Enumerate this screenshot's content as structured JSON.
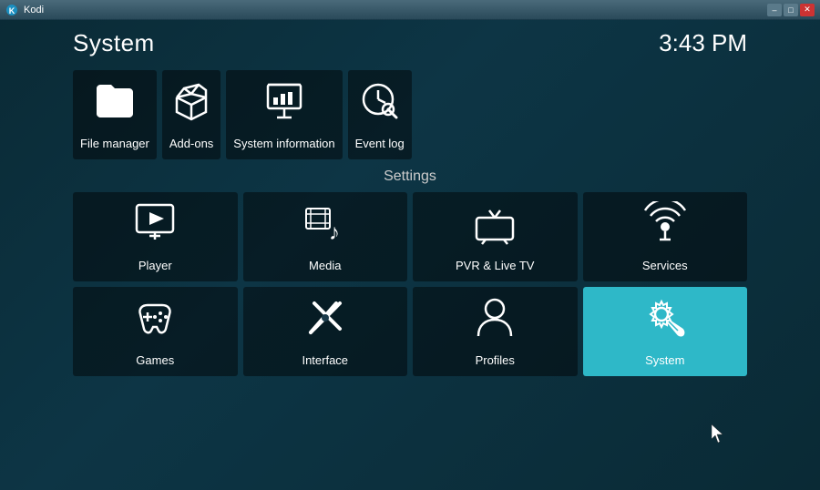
{
  "titlebar": {
    "title": "Kodi",
    "minimize": "–",
    "maximize": "□",
    "close": "✕"
  },
  "header": {
    "page_title": "System",
    "clock": "3:43 PM"
  },
  "top_items": [
    {
      "id": "file-manager",
      "label": "File manager",
      "icon": "folder"
    },
    {
      "id": "add-ons",
      "label": "Add-ons",
      "icon": "box"
    },
    {
      "id": "system-information",
      "label": "System information",
      "icon": "presentation"
    },
    {
      "id": "event-log",
      "label": "Event log",
      "icon": "clock-search"
    }
  ],
  "settings": {
    "label": "Settings",
    "items": [
      {
        "id": "player",
        "label": "Player",
        "icon": "play"
      },
      {
        "id": "media",
        "label": "Media",
        "icon": "media"
      },
      {
        "id": "pvr-live-tv",
        "label": "PVR & Live TV",
        "icon": "tv"
      },
      {
        "id": "services",
        "label": "Services",
        "icon": "podcast"
      },
      {
        "id": "games",
        "label": "Games",
        "icon": "gamepad"
      },
      {
        "id": "interface",
        "label": "Interface",
        "icon": "pen-cross"
      },
      {
        "id": "profiles",
        "label": "Profiles",
        "icon": "person"
      },
      {
        "id": "system",
        "label": "System",
        "icon": "gear-wrench",
        "active": true
      }
    ]
  }
}
